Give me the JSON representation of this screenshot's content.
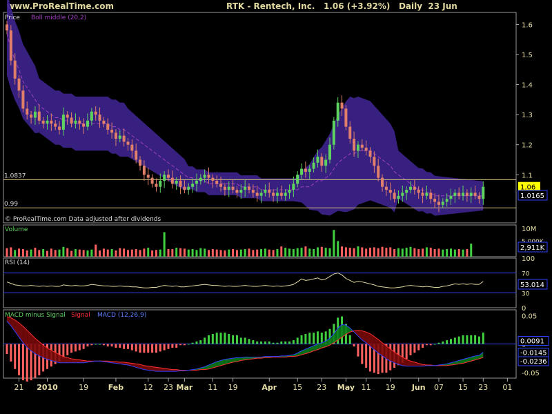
{
  "header": {
    "site": "www.ProRealTime.com",
    "title": "RTK - Rentech, Inc.",
    "quote": "1.06 (+3.92%)",
    "period": "Daily",
    "date": "23 Jun"
  },
  "chart_data": [
    {
      "type": "candlestick",
      "panel": "price",
      "labels": [
        "Price",
        "Boll middle (20,2)"
      ],
      "footnote": "© ProRealTime.com  Data adjusted after dividends",
      "ylim": [
        0.94,
        1.64
      ],
      "yticks": [
        1.1,
        1.2,
        1.3,
        1.4,
        1.5,
        1.6
      ],
      "reference_lines": [
        1.0837,
        0.99
      ],
      "last_price": 1.06,
      "value_box": "1.0165",
      "close": [
        1.58,
        1.48,
        1.42,
        1.38,
        1.32,
        1.3,
        1.29,
        1.31,
        1.28,
        1.27,
        1.28,
        1.27,
        1.26,
        1.25,
        1.3,
        1.29,
        1.27,
        1.28,
        1.27,
        1.26,
        1.28,
        1.31,
        1.3,
        1.28,
        1.27,
        1.25,
        1.24,
        1.22,
        1.23,
        1.21,
        1.2,
        1.18,
        1.15,
        1.13,
        1.1,
        1.09,
        1.07,
        1.06,
        1.08,
        1.1,
        1.09,
        1.07,
        1.08,
        1.06,
        1.05,
        1.06,
        1.07,
        1.08,
        1.09,
        1.1,
        1.09,
        1.08,
        1.07,
        1.06,
        1.05,
        1.06,
        1.05,
        1.04,
        1.05,
        1.06,
        1.05,
        1.04,
        1.03,
        1.04,
        1.05,
        1.04,
        1.03,
        1.04,
        1.03,
        1.04,
        1.05,
        1.07,
        1.1,
        1.12,
        1.11,
        1.12,
        1.14,
        1.16,
        1.13,
        1.15,
        1.2,
        1.28,
        1.34,
        1.32,
        1.26,
        1.22,
        1.18,
        1.2,
        1.19,
        1.18,
        1.16,
        1.13,
        1.09,
        1.06,
        1.05,
        1.04,
        1.02,
        1.03,
        1.04,
        1.05,
        1.06,
        1.05,
        1.04,
        1.03,
        1.04,
        1.02,
        1.01,
        1.0,
        1.01,
        1.02,
        1.03,
        1.04,
        1.03,
        1.04,
        1.03,
        1.04,
        1.03,
        1.02,
        1.06
      ],
      "bollinger_middle": [
        1.57,
        1.52,
        1.48,
        1.45,
        1.41,
        1.39,
        1.37,
        1.35,
        1.33,
        1.32,
        1.31,
        1.3,
        1.29,
        1.29,
        1.28,
        1.28,
        1.28,
        1.27,
        1.27,
        1.27,
        1.27,
        1.27,
        1.27,
        1.27,
        1.27,
        1.27,
        1.26,
        1.26,
        1.25,
        1.25,
        1.24,
        1.23,
        1.22,
        1.21,
        1.2,
        1.19,
        1.18,
        1.17,
        1.16,
        1.15,
        1.14,
        1.13,
        1.12,
        1.11,
        1.1,
        1.09,
        1.09,
        1.08,
        1.08,
        1.08,
        1.07,
        1.07,
        1.07,
        1.07,
        1.07,
        1.07,
        1.07,
        1.07,
        1.06,
        1.06,
        1.06,
        1.06,
        1.06,
        1.05,
        1.05,
        1.05,
        1.05,
        1.05,
        1.05,
        1.05,
        1.05,
        1.05,
        1.05,
        1.06,
        1.06,
        1.06,
        1.07,
        1.08,
        1.08,
        1.09,
        1.1,
        1.12,
        1.14,
        1.15,
        1.16,
        1.17,
        1.17,
        1.18,
        1.18,
        1.18,
        1.18,
        1.17,
        1.16,
        1.15,
        1.14,
        1.13,
        1.11,
        1.1,
        1.09,
        1.08,
        1.07,
        1.06,
        1.05,
        1.05,
        1.04,
        1.04,
        1.03,
        1.03,
        1.03,
        1.03,
        1.03,
        1.03,
        1.03,
        1.03,
        1.03,
        1.03,
        1.03,
        1.03,
        1.03
      ]
    },
    {
      "type": "bar",
      "panel": "volume",
      "labels": [
        "Volume"
      ],
      "ylim": [
        0,
        10000000
      ],
      "yticks": [
        "10M",
        "5,000K"
      ],
      "value_box": "2,911K",
      "values_k": [
        1900,
        2100,
        1500,
        1800,
        1700,
        1400,
        1600,
        2000,
        1500,
        1700,
        1300,
        1800,
        1500,
        1600,
        2200,
        1900,
        1300,
        1700,
        1600,
        1500,
        1400,
        1600,
        2700,
        1400,
        1800,
        1600,
        1700,
        1400,
        1900,
        1800,
        1500,
        1600,
        1700,
        1500,
        1800,
        2000,
        1400,
        1500,
        1600,
        5500,
        1700,
        1700,
        2000,
        1900,
        1800,
        1600,
        1700,
        1500,
        1900,
        1800,
        1500,
        1700,
        1600,
        1500,
        1400,
        1600,
        1700,
        1500,
        1600,
        1700,
        1800,
        1500,
        1600,
        1700,
        1800,
        1600,
        1500,
        1700,
        2300,
        2000,
        1800,
        1700,
        1900,
        2000,
        2300,
        1800,
        1700,
        2100,
        2200,
        2000,
        1900,
        6000,
        3500,
        2300,
        2100,
        2000,
        1900,
        2300,
        2100,
        1800,
        2000,
        2100,
        1900,
        2200,
        2000,
        2100,
        1700,
        1900,
        1800,
        2000,
        2200,
        1900,
        1700,
        1800,
        2100,
        2000,
        1700,
        1800,
        1600,
        1700,
        1800,
        1600,
        1700,
        1600,
        1700,
        2911
      ],
      "up_flags": [
        false,
        false,
        true,
        false,
        false,
        false,
        true,
        false,
        false,
        true,
        false,
        false,
        false,
        true,
        true,
        false,
        false,
        true,
        false,
        false,
        true,
        true,
        false,
        false,
        false,
        false,
        true,
        false,
        false,
        false,
        false,
        false,
        false,
        false,
        false,
        true,
        false,
        false,
        true,
        true,
        false,
        false,
        true,
        false,
        false,
        true,
        true,
        true,
        true,
        true,
        false,
        false,
        false,
        false,
        false,
        true,
        false,
        false,
        true,
        true,
        false,
        false,
        false,
        true,
        true,
        false,
        false,
        true,
        false,
        true,
        true,
        true,
        true,
        true,
        false,
        true,
        true,
        true,
        false,
        true,
        true,
        true,
        true,
        false,
        false,
        false,
        false,
        true,
        false,
        false,
        false,
        false,
        false,
        false,
        false,
        false,
        false,
        true,
        true,
        true,
        true,
        false,
        false,
        false,
        true,
        false,
        false,
        false,
        true,
        true,
        true,
        true,
        false,
        true,
        false,
        true,
        false,
        false,
        true
      ]
    },
    {
      "type": "line",
      "panel": "rsi",
      "labels": [
        "RSI (14)"
      ],
      "ylim": [
        0,
        100
      ],
      "yticks": [
        0,
        30,
        50,
        70,
        100
      ],
      "reference_lines": [
        70,
        30
      ],
      "value_box": "53.014",
      "values": [
        52,
        49,
        46,
        45,
        44,
        44,
        45,
        44,
        43,
        44,
        43,
        44,
        43,
        43,
        46,
        45,
        44,
        45,
        44,
        44,
        45,
        47,
        46,
        45,
        44,
        44,
        43,
        43,
        44,
        43,
        43,
        42,
        42,
        41,
        40,
        40,
        41,
        41,
        43,
        45,
        44,
        43,
        44,
        42,
        42,
        43,
        44,
        45,
        46,
        47,
        46,
        45,
        45,
        44,
        43,
        44,
        43,
        43,
        44,
        45,
        44,
        43,
        43,
        44,
        45,
        44,
        43,
        44,
        43,
        44,
        45,
        47,
        52,
        58,
        55,
        56,
        58,
        60,
        56,
        58,
        63,
        68,
        70,
        66,
        59,
        55,
        51,
        53,
        52,
        50,
        48,
        46,
        43,
        42,
        41,
        40,
        40,
        41,
        42,
        44,
        45,
        44,
        43,
        42,
        43,
        42,
        41,
        41,
        43,
        44,
        46,
        48,
        47,
        48,
        47,
        48,
        47,
        47,
        53
      ]
    },
    {
      "type": "area",
      "panel": "macd",
      "labels": [
        "MACD minus Signal",
        "Signal",
        "MACD (12,26,9)"
      ],
      "ylim": [
        -0.06,
        0.06
      ],
      "yticks": [
        0.05,
        0,
        -0.05
      ],
      "value_box": [
        "0.0091",
        "-0.0145",
        "-0.0236"
      ],
      "macd": [
        0.04,
        0.032,
        0.022,
        0.012,
        0.002,
        -0.006,
        -0.012,
        -0.017,
        -0.021,
        -0.024,
        -0.027,
        -0.029,
        -0.031,
        -0.033,
        -0.033,
        -0.033,
        -0.033,
        -0.033,
        -0.033,
        -0.033,
        -0.032,
        -0.031,
        -0.03,
        -0.03,
        -0.031,
        -0.032,
        -0.033,
        -0.034,
        -0.035,
        -0.036,
        -0.037,
        -0.039,
        -0.041,
        -0.043,
        -0.045,
        -0.046,
        -0.047,
        -0.048,
        -0.048,
        -0.048,
        -0.048,
        -0.048,
        -0.048,
        -0.047,
        -0.047,
        -0.046,
        -0.045,
        -0.044,
        -0.042,
        -0.04,
        -0.037,
        -0.034,
        -0.031,
        -0.029,
        -0.027,
        -0.026,
        -0.025,
        -0.024,
        -0.024,
        -0.023,
        -0.023,
        -0.023,
        -0.023,
        -0.023,
        -0.022,
        -0.022,
        -0.022,
        -0.022,
        -0.021,
        -0.021,
        -0.02,
        -0.019,
        -0.016,
        -0.012,
        -0.009,
        -0.006,
        -0.003,
        0.0,
        0.002,
        0.005,
        0.01,
        0.018,
        0.028,
        0.034,
        0.033,
        0.028,
        0.021,
        0.014,
        0.007,
        0.002,
        -0.004,
        -0.01,
        -0.016,
        -0.021,
        -0.026,
        -0.03,
        -0.033,
        -0.036,
        -0.038,
        -0.039,
        -0.039,
        -0.039,
        -0.039,
        -0.039,
        -0.038,
        -0.038,
        -0.038,
        -0.037,
        -0.036,
        -0.035,
        -0.033,
        -0.031,
        -0.029,
        -0.027,
        -0.025,
        -0.023,
        -0.021,
        -0.02,
        -0.0145
      ],
      "signal": [
        0.048,
        0.046,
        0.042,
        0.037,
        0.031,
        0.024,
        0.017,
        0.01,
        0.004,
        -0.002,
        -0.007,
        -0.011,
        -0.015,
        -0.019,
        -0.022,
        -0.024,
        -0.026,
        -0.027,
        -0.028,
        -0.029,
        -0.03,
        -0.03,
        -0.03,
        -0.03,
        -0.03,
        -0.03,
        -0.031,
        -0.031,
        -0.032,
        -0.032,
        -0.033,
        -0.034,
        -0.035,
        -0.036,
        -0.038,
        -0.039,
        -0.04,
        -0.041,
        -0.042,
        -0.043,
        -0.044,
        -0.045,
        -0.045,
        -0.046,
        -0.046,
        -0.046,
        -0.046,
        -0.046,
        -0.045,
        -0.045,
        -0.044,
        -0.042,
        -0.04,
        -0.038,
        -0.036,
        -0.034,
        -0.032,
        -0.031,
        -0.029,
        -0.028,
        -0.027,
        -0.026,
        -0.025,
        -0.025,
        -0.024,
        -0.024,
        -0.023,
        -0.023,
        -0.023,
        -0.023,
        -0.022,
        -0.022,
        -0.021,
        -0.019,
        -0.017,
        -0.015,
        -0.012,
        -0.01,
        -0.007,
        -0.005,
        -0.002,
        0.002,
        0.007,
        0.012,
        0.017,
        0.021,
        0.023,
        0.024,
        0.023,
        0.021,
        0.018,
        0.013,
        0.008,
        0.002,
        -0.003,
        -0.009,
        -0.014,
        -0.019,
        -0.023,
        -0.027,
        -0.03,
        -0.032,
        -0.034,
        -0.036,
        -0.037,
        -0.037,
        -0.038,
        -0.038,
        -0.038,
        -0.038,
        -0.037,
        -0.036,
        -0.035,
        -0.034,
        -0.032,
        -0.03,
        -0.028,
        -0.026,
        -0.0236
      ]
    }
  ],
  "x_axis": {
    "ticks": [
      {
        "i": 3,
        "label": "21"
      },
      {
        "i": 10,
        "label": "2010"
      },
      {
        "i": 19,
        "label": "19"
      },
      {
        "i": 27,
        "label": "Feb"
      },
      {
        "i": 35,
        "label": "12"
      },
      {
        "i": 40,
        "label": "23"
      },
      {
        "i": 44,
        "label": "Mar"
      },
      {
        "i": 51,
        "label": "11"
      },
      {
        "i": 56,
        "label": "19"
      },
      {
        "i": 65,
        "label": "Apr"
      },
      {
        "i": 72,
        "label": "15"
      },
      {
        "i": 78,
        "label": "23"
      },
      {
        "i": 84,
        "label": "May"
      },
      {
        "i": 89,
        "label": "11"
      },
      {
        "i": 95,
        "label": "19"
      },
      {
        "i": 102,
        "label": "Jun"
      },
      {
        "i": 107,
        "label": "07"
      },
      {
        "i": 113,
        "label": "15"
      },
      {
        "i": 118,
        "label": "23"
      },
      {
        "i": 124,
        "label": "01"
      }
    ]
  },
  "colors": {
    "up": "#5fd35f",
    "down": "#e0806a",
    "band": "#3b2288",
    "boll": "#a040c0",
    "ref": "#d0c080",
    "macd_line": "#3040ff",
    "signal_line": "#ff3030",
    "hist_up": "#40d040",
    "hist_down": "#ff6060",
    "axis_text": "#e8e0a8"
  }
}
